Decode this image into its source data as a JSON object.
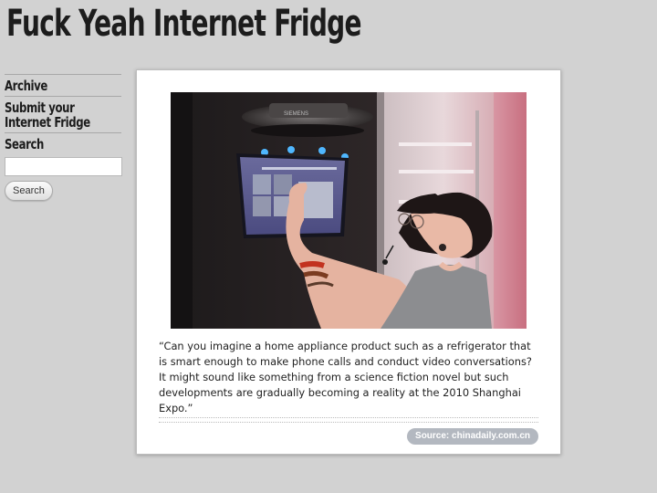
{
  "site": {
    "title": "Fuck Yeah Internet Fridge"
  },
  "sidebar": {
    "items": [
      {
        "label": "Archive"
      },
      {
        "label": "Submit your Internet Fridge"
      }
    ],
    "search": {
      "label": "Search",
      "value": "",
      "button_label": "Search"
    }
  },
  "post": {
    "photo": {
      "brand_text": "SIEMENS"
    },
    "caption": "“Can you imagine a home appliance product such as a refrigerator that is smart enough to make phone calls and conduct video conversations? It might sound like something from a science fiction novel but such developments are gradually becoming a reality at the 2010 Shanghai Expo.”",
    "source_label": "Source: chinadaily.com.cn"
  },
  "colors": {
    "page_background": "#d2d2d2",
    "card_background": "#ffffff",
    "source_pill": "#b3b8c0"
  }
}
